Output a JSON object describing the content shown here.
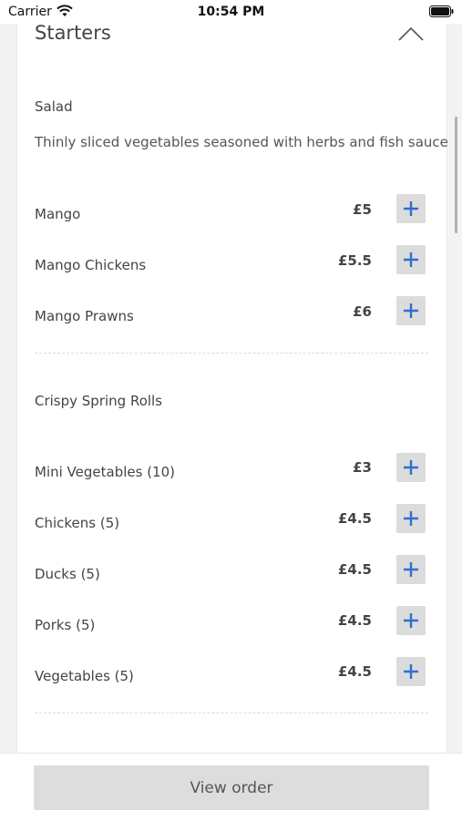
{
  "status_bar": {
    "carrier": "Carrier",
    "time": "10:54 PM"
  },
  "section": {
    "title": "Starters"
  },
  "groups": [
    {
      "title": "Salad",
      "description": "Thinly sliced vegetables seasoned with herbs and fish sauce",
      "items": [
        {
          "name": "Mango",
          "price": "£5"
        },
        {
          "name": "Mango Chickens",
          "price": "£5.5"
        },
        {
          "name": "Mango Prawns",
          "price": "£6"
        }
      ]
    },
    {
      "title": "Crispy Spring Rolls",
      "items": [
        {
          "name": "Mini Vegetables (10)",
          "price": "£3"
        },
        {
          "name": "Chickens (5)",
          "price": "£4.5"
        },
        {
          "name": "Ducks (5)",
          "price": "£4.5"
        },
        {
          "name": "Porks (5)",
          "price": "£4.5"
        },
        {
          "name": "Vegetables (5)",
          "price": "£4.5"
        }
      ]
    }
  ],
  "footer": {
    "view_order_label": "View order"
  },
  "colors": {
    "accent": "#2f6fd0",
    "button_bg": "#dcdcdc"
  }
}
